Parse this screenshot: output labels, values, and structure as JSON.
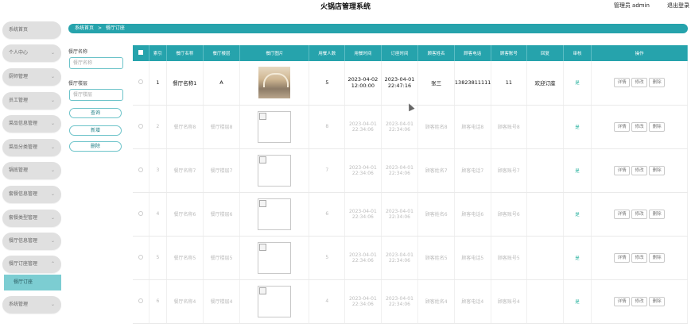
{
  "app": {
    "title": "火锅店管理系统",
    "user": "管理员 admin",
    "logout": "退出登录"
  },
  "sidebar": {
    "items": [
      {
        "label": "系统首页",
        "chevron": ""
      },
      {
        "label": "个人中心",
        "chevron": "⌄"
      },
      {
        "label": "厨师管理",
        "chevron": "⌄"
      },
      {
        "label": "员工管理",
        "chevron": "⌄"
      },
      {
        "label": "菜品信息管理",
        "chevron": "⌄"
      },
      {
        "label": "菜品分类管理",
        "chevron": "⌄"
      },
      {
        "label": "锅底管理",
        "chevron": "⌄"
      },
      {
        "label": "套餐信息管理",
        "chevron": "⌄"
      },
      {
        "label": "套餐类型管理",
        "chevron": "⌄"
      },
      {
        "label": "餐厅信息管理",
        "chevron": "⌄"
      },
      {
        "label": "餐厅订座管理",
        "chevron": "⌃"
      },
      {
        "label": "系统管理",
        "chevron": "⌄"
      }
    ],
    "active_sub": "餐厅订座"
  },
  "breadcrumb": {
    "home": "系统首页",
    "sep": ">",
    "current": "餐厅订座"
  },
  "filter": {
    "name_label": "餐厅名称",
    "name_placeholder": "餐厅名称",
    "building_label": "餐厅楼层",
    "building_placeholder": "餐厅楼层",
    "search": "查询",
    "add": "新增",
    "delete": "删除"
  },
  "table": {
    "columns": [
      "索引",
      "餐厅名称",
      "餐厅楼层",
      "餐厅图片",
      "用餐人数",
      "用餐时间",
      "订座时间",
      "顾客姓名",
      "顾客电话",
      "顾客账号",
      "回复",
      "审核",
      "操作"
    ],
    "rows": [
      {
        "index": "1",
        "name": "餐厅名称1",
        "floor": "A",
        "image": "photo",
        "people": "5",
        "meal_time": "2023-04-02 12:00:00",
        "book_time": "2023-04-01 22:47:16",
        "cust_name": "张三",
        "cust_phone": "13823811111",
        "cust_account": "11",
        "reply": "欢迎订座",
        "status": "是"
      },
      {
        "index": "2",
        "name": "餐厅名称8",
        "floor": "餐厅楼层8",
        "image": "broken",
        "people": "8",
        "meal_time": "2023-04-01 22:34:06",
        "book_time": "2023-04-01 22:34:06",
        "cust_name": "顾客姓名8",
        "cust_phone": "顾客电话8",
        "cust_account": "顾客账号8",
        "reply": "",
        "status": "是"
      },
      {
        "index": "3",
        "name": "餐厅名称7",
        "floor": "餐厅楼层7",
        "image": "broken",
        "people": "7",
        "meal_time": "2023-04-01 22:34:06",
        "book_time": "2023-04-01 22:34:06",
        "cust_name": "顾客姓名7",
        "cust_phone": "顾客电话7",
        "cust_account": "顾客账号7",
        "reply": "",
        "status": "是"
      },
      {
        "index": "4",
        "name": "餐厅名称6",
        "floor": "餐厅楼层6",
        "image": "broken",
        "people": "6",
        "meal_time": "2023-04-01 22:34:06",
        "book_time": "2023-04-01 22:34:06",
        "cust_name": "顾客姓名6",
        "cust_phone": "顾客电话6",
        "cust_account": "顾客账号6",
        "reply": "",
        "status": "是"
      },
      {
        "index": "5",
        "name": "餐厅名称5",
        "floor": "餐厅楼层5",
        "image": "broken",
        "people": "5",
        "meal_time": "2023-04-01 22:34:06",
        "book_time": "2023-04-01 22:34:06",
        "cust_name": "顾客姓名5",
        "cust_phone": "顾客电话5",
        "cust_account": "顾客账号5",
        "reply": "",
        "status": "是"
      },
      {
        "index": "6",
        "name": "餐厅名称4",
        "floor": "餐厅楼层4",
        "image": "broken",
        "people": "4",
        "meal_time": "2023-04-01 22:34:06",
        "book_time": "2023-04-01 22:34:06",
        "cust_name": "顾客姓名4",
        "cust_phone": "顾客电话4",
        "cust_account": "顾客账号4",
        "reply": "",
        "status": "是"
      }
    ],
    "actions": [
      "详情",
      "修改",
      "删除"
    ]
  },
  "colors": {
    "primary": "#26a3ac",
    "sidebar_item": "#e0e0e0",
    "active_sub": "#7ccdd2",
    "status": "#2bb3a0"
  }
}
